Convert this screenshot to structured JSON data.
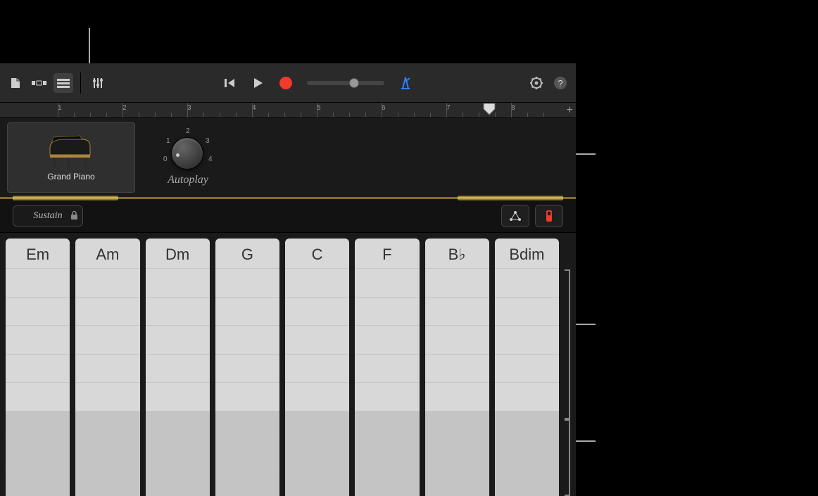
{
  "toolbar": {
    "view_browser_label": "browser",
    "view_tracks_label": "tracks",
    "view_list_label": "list",
    "mixer_label": "mixer",
    "metronome_color": "#2a7fff"
  },
  "ruler": {
    "bars": [
      "1",
      "2",
      "3",
      "4",
      "5",
      "6",
      "7",
      "8"
    ],
    "playhead_bar": 7.1,
    "add_label": "+"
  },
  "instrument": {
    "name": "Grand Piano",
    "autoplay_label": "Autoplay",
    "dial_marks": [
      "0",
      "1",
      "2",
      "3",
      "4"
    ]
  },
  "controls": {
    "sustain_label": "Sustain"
  },
  "chords": [
    "Em",
    "Am",
    "Dm",
    "G",
    "C",
    "F",
    "B♭",
    "Bdim"
  ],
  "chord_segments": {
    "light_count": 5,
    "dark_count": 3
  }
}
